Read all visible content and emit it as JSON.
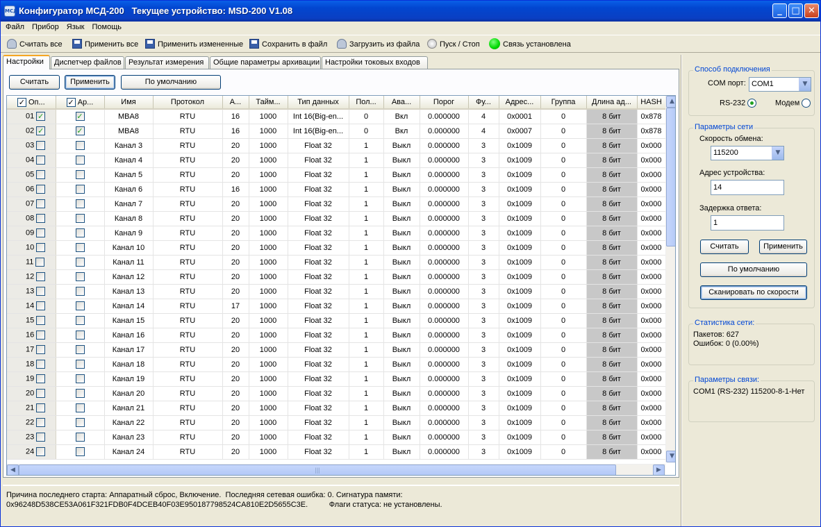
{
  "window": {
    "title": "Конфигуратор МСД-200   Текущее устройство: MSD-200 V1.08",
    "app_icon": "МСД"
  },
  "menu": [
    "Файл",
    "Прибор",
    "Язык",
    "Помощь"
  ],
  "toolbar": {
    "read_all": "Считать все",
    "apply_all": "Применить все",
    "apply_changed": "Применить измененные",
    "save_file": "Сохранить в файл",
    "load_file": "Загрузить из файла",
    "start_stop": "Пуск / Стоп",
    "connection": "Связь установлена",
    "connection_color": "#00d800"
  },
  "tabs": [
    "Настройки",
    "Диспетчер файлов",
    "Результат измерения",
    "Общие параметры архивации",
    "Настройки токовых входов"
  ],
  "panel_buttons": {
    "read": "Считать",
    "apply": "Применить",
    "default": "По умолчанию"
  },
  "columns": [
    "Оп...",
    "Ар...",
    "Имя",
    "Протокол",
    "А...",
    "Тайм...",
    "Тип данных",
    "Пол...",
    "Ава...",
    "Порог",
    "Фу...",
    "Адрес...",
    "Группа",
    "Длина ад...",
    "HASH"
  ],
  "rows": [
    {
      "n": "01",
      "op": true,
      "ar": true,
      "name": "MBA8",
      "proto": "RTU",
      "a": "16",
      "time": "1000",
      "type": "Int 16(Big-en...",
      "pol": "0",
      "ava": "Вкл",
      "thr": "0.000000",
      "fn": "4",
      "addr": "0x0001",
      "grp": "0",
      "len": "8 бит",
      "hash": "0x878"
    },
    {
      "n": "02",
      "op": true,
      "ar": true,
      "name": "MBA8",
      "proto": "RTU",
      "a": "16",
      "time": "1000",
      "type": "Int 16(Big-en...",
      "pol": "0",
      "ava": "Вкл",
      "thr": "0.000000",
      "fn": "4",
      "addr": "0x0007",
      "grp": "0",
      "len": "8 бит",
      "hash": "0x878"
    },
    {
      "n": "03",
      "op": false,
      "ar": false,
      "name": "Канал 3",
      "proto": "RTU",
      "a": "20",
      "time": "1000",
      "type": "Float 32",
      "pol": "1",
      "ava": "Выкл",
      "thr": "0.000000",
      "fn": "3",
      "addr": "0x1009",
      "grp": "0",
      "len": "8 бит",
      "hash": "0x000"
    },
    {
      "n": "04",
      "op": false,
      "ar": false,
      "name": "Канал 4",
      "proto": "RTU",
      "a": "20",
      "time": "1000",
      "type": "Float 32",
      "pol": "1",
      "ava": "Выкл",
      "thr": "0.000000",
      "fn": "3",
      "addr": "0x1009",
      "grp": "0",
      "len": "8 бит",
      "hash": "0x000"
    },
    {
      "n": "05",
      "op": false,
      "ar": false,
      "name": "Канал 5",
      "proto": "RTU",
      "a": "20",
      "time": "1000",
      "type": "Float 32",
      "pol": "1",
      "ava": "Выкл",
      "thr": "0.000000",
      "fn": "3",
      "addr": "0x1009",
      "grp": "0",
      "len": "8 бит",
      "hash": "0x000"
    },
    {
      "n": "06",
      "op": false,
      "ar": false,
      "name": "Канал 6",
      "proto": "RTU",
      "a": "16",
      "time": "1000",
      "type": "Float 32",
      "pol": "1",
      "ava": "Выкл",
      "thr": "0.000000",
      "fn": "3",
      "addr": "0x1009",
      "grp": "0",
      "len": "8 бит",
      "hash": "0x000"
    },
    {
      "n": "07",
      "op": false,
      "ar": false,
      "name": "Канал 7",
      "proto": "RTU",
      "a": "20",
      "time": "1000",
      "type": "Float 32",
      "pol": "1",
      "ava": "Выкл",
      "thr": "0.000000",
      "fn": "3",
      "addr": "0x1009",
      "grp": "0",
      "len": "8 бит",
      "hash": "0x000"
    },
    {
      "n": "08",
      "op": false,
      "ar": false,
      "name": "Канал 8",
      "proto": "RTU",
      "a": "20",
      "time": "1000",
      "type": "Float 32",
      "pol": "1",
      "ava": "Выкл",
      "thr": "0.000000",
      "fn": "3",
      "addr": "0x1009",
      "grp": "0",
      "len": "8 бит",
      "hash": "0x000"
    },
    {
      "n": "09",
      "op": false,
      "ar": false,
      "name": "Канал 9",
      "proto": "RTU",
      "a": "20",
      "time": "1000",
      "type": "Float 32",
      "pol": "1",
      "ava": "Выкл",
      "thr": "0.000000",
      "fn": "3",
      "addr": "0x1009",
      "grp": "0",
      "len": "8 бит",
      "hash": "0x000"
    },
    {
      "n": "10",
      "op": false,
      "ar": false,
      "name": "Канал 10",
      "proto": "RTU",
      "a": "20",
      "time": "1000",
      "type": "Float 32",
      "pol": "1",
      "ava": "Выкл",
      "thr": "0.000000",
      "fn": "3",
      "addr": "0x1009",
      "grp": "0",
      "len": "8 бит",
      "hash": "0x000"
    },
    {
      "n": "11",
      "op": false,
      "ar": false,
      "name": "Канал 11",
      "proto": "RTU",
      "a": "20",
      "time": "1000",
      "type": "Float 32",
      "pol": "1",
      "ava": "Выкл",
      "thr": "0.000000",
      "fn": "3",
      "addr": "0x1009",
      "grp": "0",
      "len": "8 бит",
      "hash": "0x000"
    },
    {
      "n": "12",
      "op": false,
      "ar": false,
      "name": "Канал 12",
      "proto": "RTU",
      "a": "20",
      "time": "1000",
      "type": "Float 32",
      "pol": "1",
      "ava": "Выкл",
      "thr": "0.000000",
      "fn": "3",
      "addr": "0x1009",
      "grp": "0",
      "len": "8 бит",
      "hash": "0x000"
    },
    {
      "n": "13",
      "op": false,
      "ar": false,
      "name": "Канал 13",
      "proto": "RTU",
      "a": "20",
      "time": "1000",
      "type": "Float 32",
      "pol": "1",
      "ava": "Выкл",
      "thr": "0.000000",
      "fn": "3",
      "addr": "0x1009",
      "grp": "0",
      "len": "8 бит",
      "hash": "0x000"
    },
    {
      "n": "14",
      "op": false,
      "ar": false,
      "name": "Канал 14",
      "proto": "RTU",
      "a": "17",
      "time": "1000",
      "type": "Float 32",
      "pol": "1",
      "ava": "Выкл",
      "thr": "0.000000",
      "fn": "3",
      "addr": "0x1009",
      "grp": "0",
      "len": "8 бит",
      "hash": "0x000"
    },
    {
      "n": "15",
      "op": false,
      "ar": false,
      "name": "Канал 15",
      "proto": "RTU",
      "a": "20",
      "time": "1000",
      "type": "Float 32",
      "pol": "1",
      "ava": "Выкл",
      "thr": "0.000000",
      "fn": "3",
      "addr": "0x1009",
      "grp": "0",
      "len": "8 бит",
      "hash": "0x000"
    },
    {
      "n": "16",
      "op": false,
      "ar": false,
      "name": "Канал 16",
      "proto": "RTU",
      "a": "20",
      "time": "1000",
      "type": "Float 32",
      "pol": "1",
      "ava": "Выкл",
      "thr": "0.000000",
      "fn": "3",
      "addr": "0x1009",
      "grp": "0",
      "len": "8 бит",
      "hash": "0x000"
    },
    {
      "n": "17",
      "op": false,
      "ar": false,
      "name": "Канал 17",
      "proto": "RTU",
      "a": "20",
      "time": "1000",
      "type": "Float 32",
      "pol": "1",
      "ava": "Выкл",
      "thr": "0.000000",
      "fn": "3",
      "addr": "0x1009",
      "grp": "0",
      "len": "8 бит",
      "hash": "0x000"
    },
    {
      "n": "18",
      "op": false,
      "ar": false,
      "name": "Канал 18",
      "proto": "RTU",
      "a": "20",
      "time": "1000",
      "type": "Float 32",
      "pol": "1",
      "ava": "Выкл",
      "thr": "0.000000",
      "fn": "3",
      "addr": "0x1009",
      "grp": "0",
      "len": "8 бит",
      "hash": "0x000"
    },
    {
      "n": "19",
      "op": false,
      "ar": false,
      "name": "Канал 19",
      "proto": "RTU",
      "a": "20",
      "time": "1000",
      "type": "Float 32",
      "pol": "1",
      "ava": "Выкл",
      "thr": "0.000000",
      "fn": "3",
      "addr": "0x1009",
      "grp": "0",
      "len": "8 бит",
      "hash": "0x000"
    },
    {
      "n": "20",
      "op": false,
      "ar": false,
      "name": "Канал 20",
      "proto": "RTU",
      "a": "20",
      "time": "1000",
      "type": "Float 32",
      "pol": "1",
      "ava": "Выкл",
      "thr": "0.000000",
      "fn": "3",
      "addr": "0x1009",
      "grp": "0",
      "len": "8 бит",
      "hash": "0x000"
    },
    {
      "n": "21",
      "op": false,
      "ar": false,
      "name": "Канал 21",
      "proto": "RTU",
      "a": "20",
      "time": "1000",
      "type": "Float 32",
      "pol": "1",
      "ava": "Выкл",
      "thr": "0.000000",
      "fn": "3",
      "addr": "0x1009",
      "grp": "0",
      "len": "8 бит",
      "hash": "0x000"
    },
    {
      "n": "22",
      "op": false,
      "ar": false,
      "name": "Канал 22",
      "proto": "RTU",
      "a": "20",
      "time": "1000",
      "type": "Float 32",
      "pol": "1",
      "ava": "Выкл",
      "thr": "0.000000",
      "fn": "3",
      "addr": "0x1009",
      "grp": "0",
      "len": "8 бит",
      "hash": "0x000"
    },
    {
      "n": "23",
      "op": false,
      "ar": false,
      "name": "Канал 23",
      "proto": "RTU",
      "a": "20",
      "time": "1000",
      "type": "Float 32",
      "pol": "1",
      "ava": "Выкл",
      "thr": "0.000000",
      "fn": "3",
      "addr": "0x1009",
      "grp": "0",
      "len": "8 бит",
      "hash": "0x000"
    },
    {
      "n": "24",
      "op": false,
      "ar": false,
      "name": "Канал 24",
      "proto": "RTU",
      "a": "20",
      "time": "1000",
      "type": "Float 32",
      "pol": "1",
      "ava": "Выкл",
      "thr": "0.000000",
      "fn": "3",
      "addr": "0x1009",
      "grp": "0",
      "len": "8 бит",
      "hash": "0x000"
    }
  ],
  "status": {
    "line1": "Причина последнего старта: Аппаратный сброс, Включение.  Последняя сетевая ошибка: 0. Сигнатура памяти:",
    "line2": "0x96248D538CE53A061F321FDB0F4DCEB40F03E950187798524CA810E2D5655C3E.          Флаги статуса: не установлены."
  },
  "connection_method": {
    "title": "Способ подключения",
    "port_label": "COM порт:",
    "port_value": "COM1",
    "rs232": "RS-232",
    "modem": "Модем",
    "selected": "RS-232"
  },
  "network_params": {
    "title": "Параметры сети",
    "speed_label": "Скорость обмена:",
    "speed_value": "115200",
    "address_label": "Адрес устройства:",
    "address_value": "14",
    "delay_label": "Задержка ответа:",
    "delay_value": "1",
    "read": "Считать",
    "apply": "Применить",
    "default": "По умолчанию",
    "scan": "Сканировать по скорости"
  },
  "network_stats": {
    "title": "Статистика сети:",
    "packets": "Пакетов: 627",
    "errors": "Ошибок: 0 (0.00%)"
  },
  "link_params": {
    "title": "Параметры связи:",
    "value": "COM1 (RS-232)  115200-8-1-Нет"
  }
}
